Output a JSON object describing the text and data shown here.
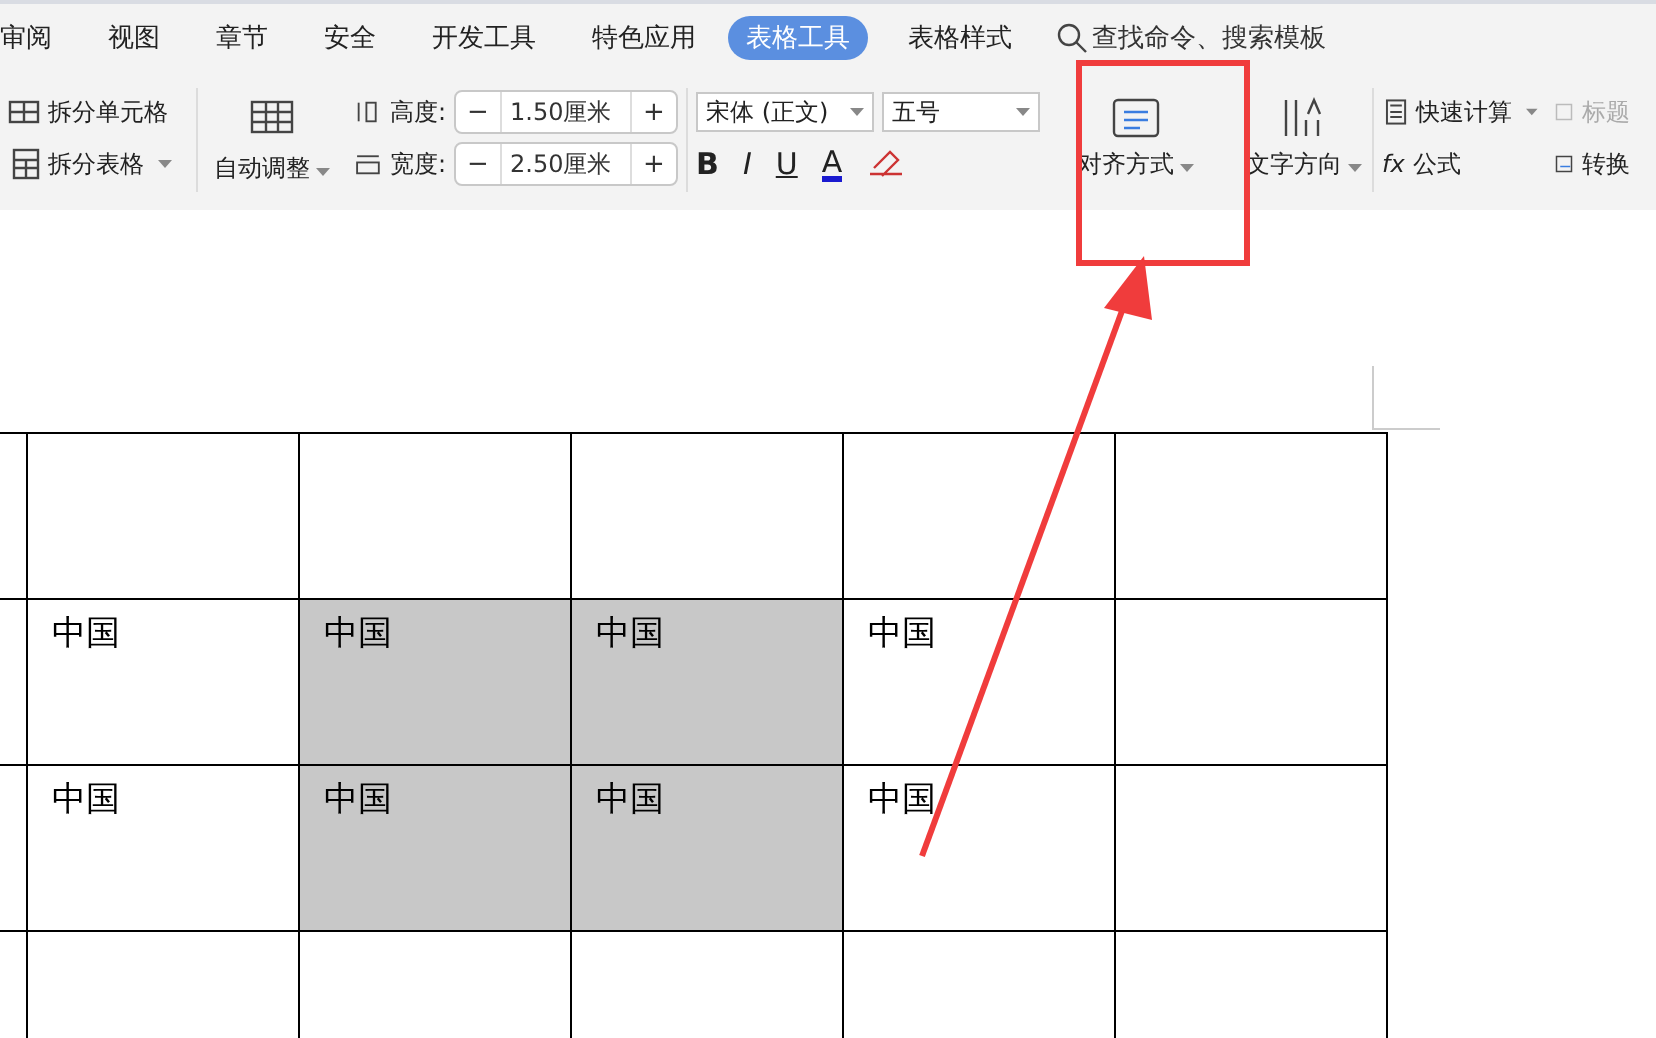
{
  "menu_tabs": [
    {
      "label": "审阅",
      "selected": false
    },
    {
      "label": "视图",
      "selected": false
    },
    {
      "label": "章节",
      "selected": false
    },
    {
      "label": "安全",
      "selected": false
    },
    {
      "label": "开发工具",
      "selected": false
    },
    {
      "label": "特色应用",
      "selected": false
    },
    {
      "label": "表格工具",
      "selected": true
    },
    {
      "label": "表格样式",
      "selected": false
    }
  ],
  "search": {
    "placeholder": "查找命令、搜索模板"
  },
  "toolbar": {
    "split_cells": "拆分单元格",
    "split_table": "拆分表格",
    "auto_fit": "自动调整",
    "height": {
      "label": "高度:",
      "value": "1.50厘米",
      "minus": "−",
      "plus": "+"
    },
    "width": {
      "label": "宽度:",
      "value": "2.50厘米",
      "minus": "−",
      "plus": "+"
    },
    "font": {
      "value": "宋体 (正文)"
    },
    "size": {
      "value": "五号"
    },
    "format_buttons": [
      "B",
      "I",
      "U",
      "A"
    ],
    "alignment": "对齐方式",
    "text_direction": "文字方向",
    "quick_calc": "快速计算",
    "title_row": {
      "label": "标题",
      "disabled": true
    },
    "formula_prefix": "fx",
    "formula": "公式",
    "convert": "转换"
  },
  "table": {
    "rows": [
      {
        "cells": [
          {
            "text": "",
            "selected": false
          },
          {
            "text": "",
            "selected": false
          },
          {
            "text": "",
            "selected": false
          },
          {
            "text": "",
            "selected": false
          },
          {
            "text": "",
            "selected": false
          },
          {
            "text": "",
            "selected": false
          }
        ]
      },
      {
        "cells": [
          {
            "text": "",
            "selected": false
          },
          {
            "text": "中国",
            "selected": false
          },
          {
            "text": "中国",
            "selected": true
          },
          {
            "text": "中国",
            "selected": true
          },
          {
            "text": "中国",
            "selected": false
          },
          {
            "text": "",
            "selected": false
          }
        ]
      },
      {
        "cells": [
          {
            "text": "",
            "selected": false
          },
          {
            "text": "中国",
            "selected": false
          },
          {
            "text": "中国",
            "selected": true
          },
          {
            "text": "中国",
            "selected": true
          },
          {
            "text": "中国",
            "selected": false
          },
          {
            "text": "",
            "selected": false
          }
        ]
      },
      {
        "cells": [
          {
            "text": "",
            "selected": false
          },
          {
            "text": "",
            "selected": false
          },
          {
            "text": "",
            "selected": false
          },
          {
            "text": "",
            "selected": false
          },
          {
            "text": "",
            "selected": false
          },
          {
            "text": "",
            "selected": false
          }
        ]
      }
    ]
  }
}
